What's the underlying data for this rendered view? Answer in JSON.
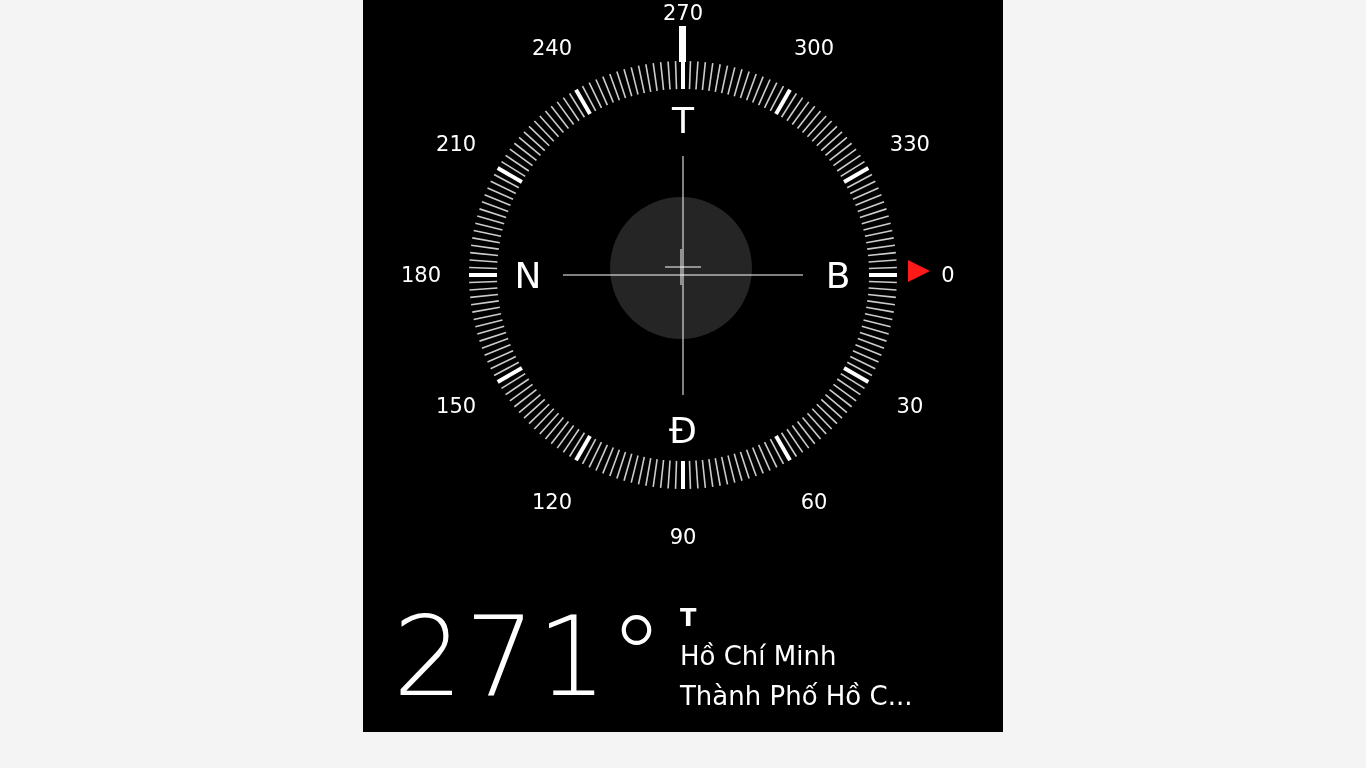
{
  "compass": {
    "degree_labels": [
      "0",
      "30",
      "60",
      "90",
      "120",
      "150",
      "180",
      "210",
      "240",
      "270",
      "300",
      "330"
    ],
    "cardinals": [
      "B",
      "Đ",
      "N",
      "T"
    ]
  },
  "readout": {
    "heading": "271°",
    "direction": "T",
    "place_lines": [
      "Hồ Chí Minh",
      "Thành Phố Hồ C..."
    ]
  }
}
